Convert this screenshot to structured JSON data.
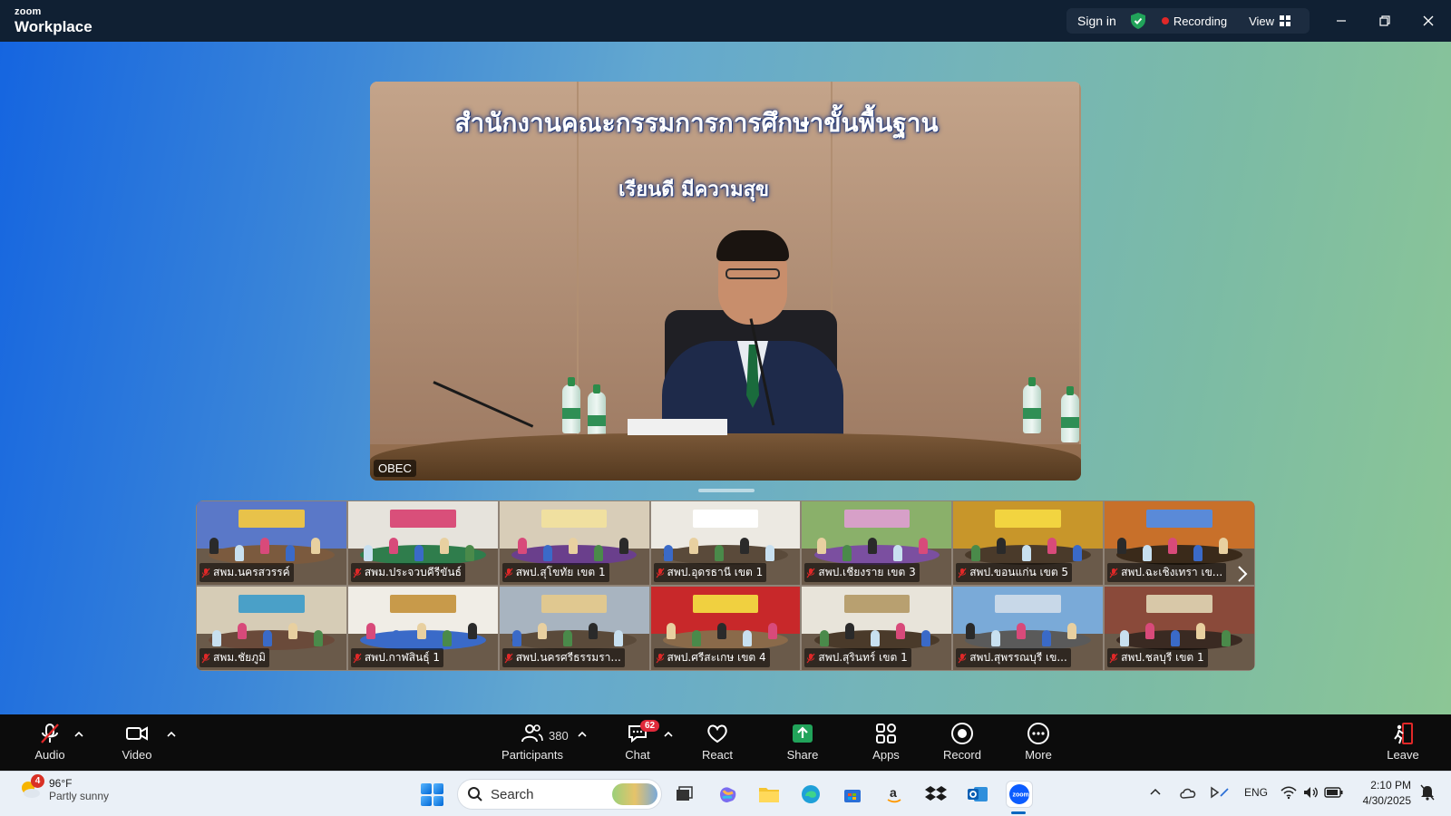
{
  "titlebar": {
    "brand_small": "zoom",
    "brand_big": "Workplace",
    "sign_in": "Sign in",
    "recording": "Recording",
    "view": "View"
  },
  "main_video": {
    "banner_line1": "สำนักงานคณะกรรมการการศึกษาขั้นพื้นฐาน",
    "banner_line2": "เรียนดี มีความสุข",
    "participant_name": "OBEC"
  },
  "gallery": {
    "tiles": [
      {
        "name": "สพม.นครสวรรค์",
        "wall": "#5a78c8",
        "table": "#7b5a3e",
        "sign": "#e8c24a"
      },
      {
        "name": "สพม.ประจวบคีรีขันธ์",
        "wall": "#e6e3dc",
        "table": "#2f7d4c",
        "sign": "#d94f7a"
      },
      {
        "name": "สพป.สุโขทัย เขต 1",
        "wall": "#d8cdb8",
        "table": "#6a3f8c",
        "sign": "#f0e0a0"
      },
      {
        "name": "สพป.อุดรธานี เขต 1",
        "wall": "#ece9e2",
        "table": "#5a4a3a",
        "sign": "#ffffff"
      },
      {
        "name": "สพป.เชียงราย เขต 3",
        "wall": "#8ab06a",
        "table": "#7b4fa0",
        "sign": "#d7a0c8"
      },
      {
        "name": "สพป.ขอนแก่น เขต 5",
        "wall": "#c8962a",
        "table": "#4a3a2a",
        "sign": "#f2d440"
      },
      {
        "name": "สพป.ฉะเชิงเทรา เข...",
        "wall": "#c8702a",
        "table": "#3a2a1a",
        "sign": "#5a8ad8"
      },
      {
        "name": "สพม.ชัยภูมิ",
        "wall": "#d6ccb6",
        "table": "#6a4a3a",
        "sign": "#4aa0c8"
      },
      {
        "name": "สพป.กาฬสินธุ์ 1",
        "wall": "#f0ede6",
        "table": "#3a6ac8",
        "sign": "#c89a4a"
      },
      {
        "name": "สพป.นครศรีธรรมรา...",
        "wall": "#a8b4c0",
        "table": "#5a4a3a",
        "sign": "#e0c890"
      },
      {
        "name": "สพป.ศรีสะเกษ เขต 4",
        "wall": "#c8282a",
        "table": "#8a6a4a",
        "sign": "#f0d040"
      },
      {
        "name": "สพป.สุรินทร์ เขต 1",
        "wall": "#e8e4da",
        "table": "#4a3a2a",
        "sign": "#b8a070"
      },
      {
        "name": "สพป.สุพรรณบุรี เข...",
        "wall": "#7aaad8",
        "table": "#5a5a5a",
        "sign": "#c8d8e8"
      },
      {
        "name": "สพป.ชลบุรี เขต 1",
        "wall": "#8a4a3a",
        "table": "#3a2a22",
        "sign": "#d8c8a8"
      }
    ]
  },
  "toolbar": {
    "audio": "Audio",
    "video": "Video",
    "participants": "Participants",
    "participant_count": "380",
    "chat": "Chat",
    "chat_badge": "62",
    "react": "React",
    "share": "Share",
    "apps": "Apps",
    "record": "Record",
    "more": "More",
    "leave": "Leave"
  },
  "taskbar": {
    "weather_badge": "4",
    "temperature": "96°F",
    "condition": "Partly sunny",
    "search_placeholder": "Search",
    "language": "ENG",
    "time": "2:10 PM",
    "date": "4/30/2025"
  },
  "colors": {
    "accent_green": "#21a35a",
    "record_red": "#e02828",
    "zoom_blue": "#0b5cff"
  }
}
